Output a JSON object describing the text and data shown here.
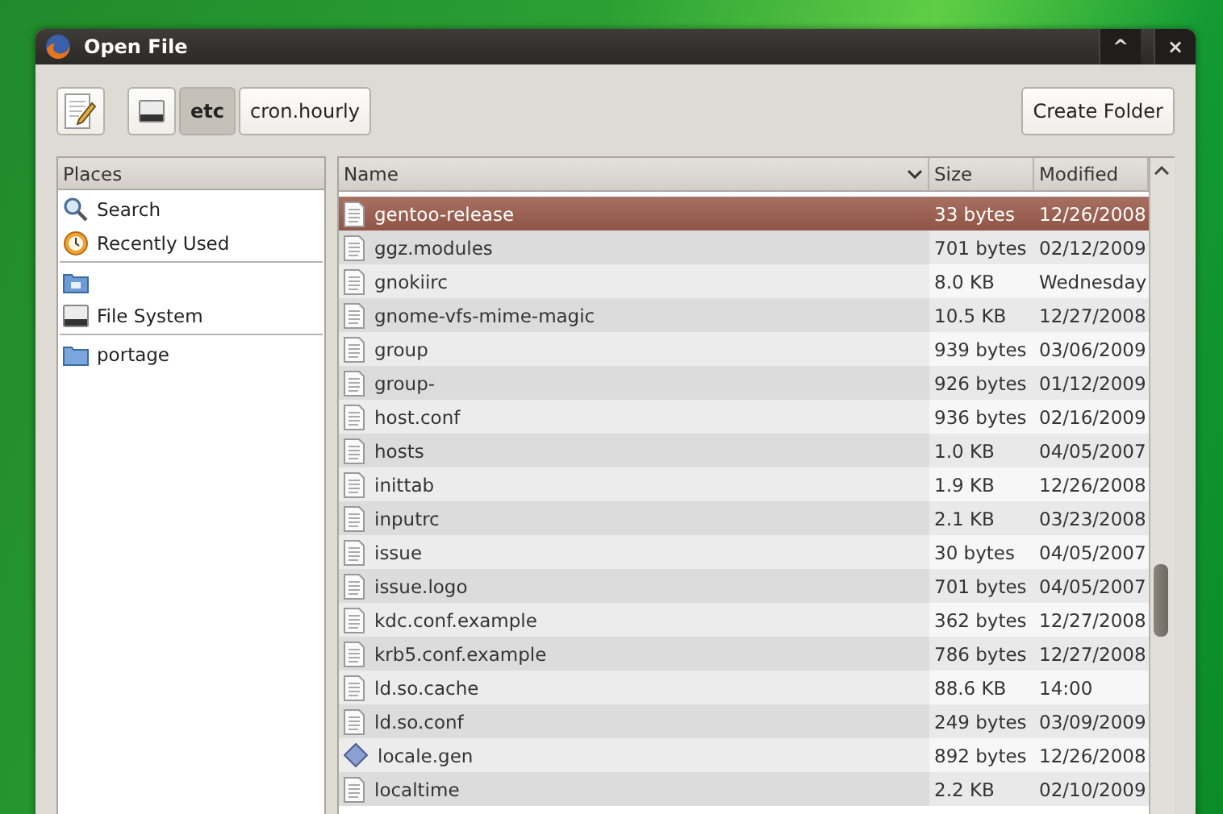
{
  "window": {
    "title": "Open File",
    "buttons": [
      "^",
      "×"
    ]
  },
  "toolbar": {
    "path": [
      {
        "kind": "drive",
        "selected": false
      },
      {
        "kind": "text",
        "label": "etc",
        "selected": true
      },
      {
        "kind": "text",
        "label": "cron.hourly",
        "selected": false
      }
    ],
    "create_folder": "Create Folder"
  },
  "places": {
    "header": "Places",
    "sections": [
      [
        {
          "kind": "search",
          "label": "Search"
        },
        {
          "kind": "recent",
          "label": "Recently Used"
        }
      ],
      [
        {
          "kind": "desktop"
        },
        {
          "kind": "drive",
          "label": "File System"
        }
      ],
      [
        {
          "kind": "folder",
          "label": "portage"
        }
      ]
    ]
  },
  "table": {
    "columns": [
      "Name",
      "Size",
      "Modified"
    ],
    "rows": [
      {
        "kind": "text",
        "name": "gentoo-release",
        "size": "33 bytes",
        "modified": "12/26/2008",
        "selected": true
      },
      {
        "kind": "text",
        "name": "ggz.modules",
        "size": "701 bytes",
        "modified": "02/12/2009",
        "selected": false
      },
      {
        "kind": "text",
        "name": "gnokiirc",
        "size": "8.0 KB",
        "modified": "Wednesday",
        "selected": false
      },
      {
        "kind": "text",
        "name": "gnome-vfs-mime-magic",
        "size": "10.5 KB",
        "modified": "12/27/2008",
        "selected": false
      },
      {
        "kind": "text",
        "name": "group",
        "size": "939 bytes",
        "modified": "03/06/2009",
        "selected": false
      },
      {
        "kind": "text",
        "name": "group-",
        "size": "926 bytes",
        "modified": "01/12/2009",
        "selected": false
      },
      {
        "kind": "text",
        "name": "host.conf",
        "size": "936 bytes",
        "modified": "02/16/2009",
        "selected": false
      },
      {
        "kind": "text",
        "name": "hosts",
        "size": "1.0 KB",
        "modified": "04/05/2007",
        "selected": false
      },
      {
        "kind": "text",
        "name": "inittab",
        "size": "1.9 KB",
        "modified": "12/26/2008",
        "selected": false
      },
      {
        "kind": "text",
        "name": "inputrc",
        "size": "2.1 KB",
        "modified": "03/23/2008",
        "selected": false
      },
      {
        "kind": "text",
        "name": "issue",
        "size": "30 bytes",
        "modified": "04/05/2007",
        "selected": false
      },
      {
        "kind": "text",
        "name": "issue.logo",
        "size": "701 bytes",
        "modified": "04/05/2007",
        "selected": false
      },
      {
        "kind": "text",
        "name": "kdc.conf.example",
        "size": "362 bytes",
        "modified": "12/27/2008",
        "selected": false
      },
      {
        "kind": "text",
        "name": "krb5.conf.example",
        "size": "786 bytes",
        "modified": "12/27/2008",
        "selected": false
      },
      {
        "kind": "text",
        "name": "ld.so.cache",
        "size": "88.6 KB",
        "modified": "14:00",
        "selected": false
      },
      {
        "kind": "text",
        "name": "ld.so.conf",
        "size": "249 bytes",
        "modified": "03/09/2009",
        "selected": false
      },
      {
        "kind": "source",
        "name": "locale.gen",
        "size": "892 bytes",
        "modified": "12/26/2008",
        "selected": false
      },
      {
        "kind": "text",
        "name": "localtime",
        "size": "2.2 KB",
        "modified": "02/10/2009",
        "selected": false
      }
    ]
  }
}
